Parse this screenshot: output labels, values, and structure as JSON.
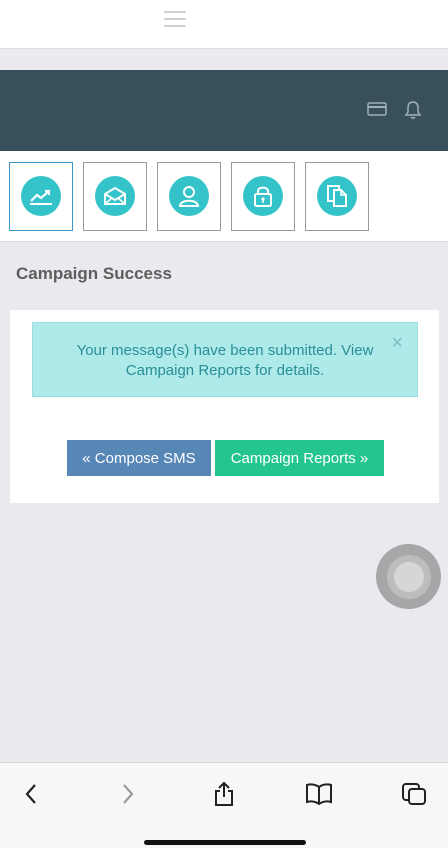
{
  "header": {
    "icons": [
      "card-icon",
      "bell-icon"
    ]
  },
  "nav_icons": [
    "chart-icon",
    "envelope-icon",
    "user-icon",
    "lock-icon",
    "documents-icon"
  ],
  "page": {
    "title": "Campaign Success"
  },
  "alert": {
    "message": "Your message(s) have been submitted. View Campaign Reports for details.",
    "close_glyph": "×"
  },
  "buttons": {
    "compose": "« Compose SMS",
    "reports": "Campaign Reports »"
  },
  "colors": {
    "header_bg": "#37505c",
    "icon_circle": "#33c3c8",
    "alert_bg": "#aeeaea",
    "alert_text": "#2a8f96",
    "compose_btn": "#5787b7",
    "reports_btn": "#24c58f"
  }
}
